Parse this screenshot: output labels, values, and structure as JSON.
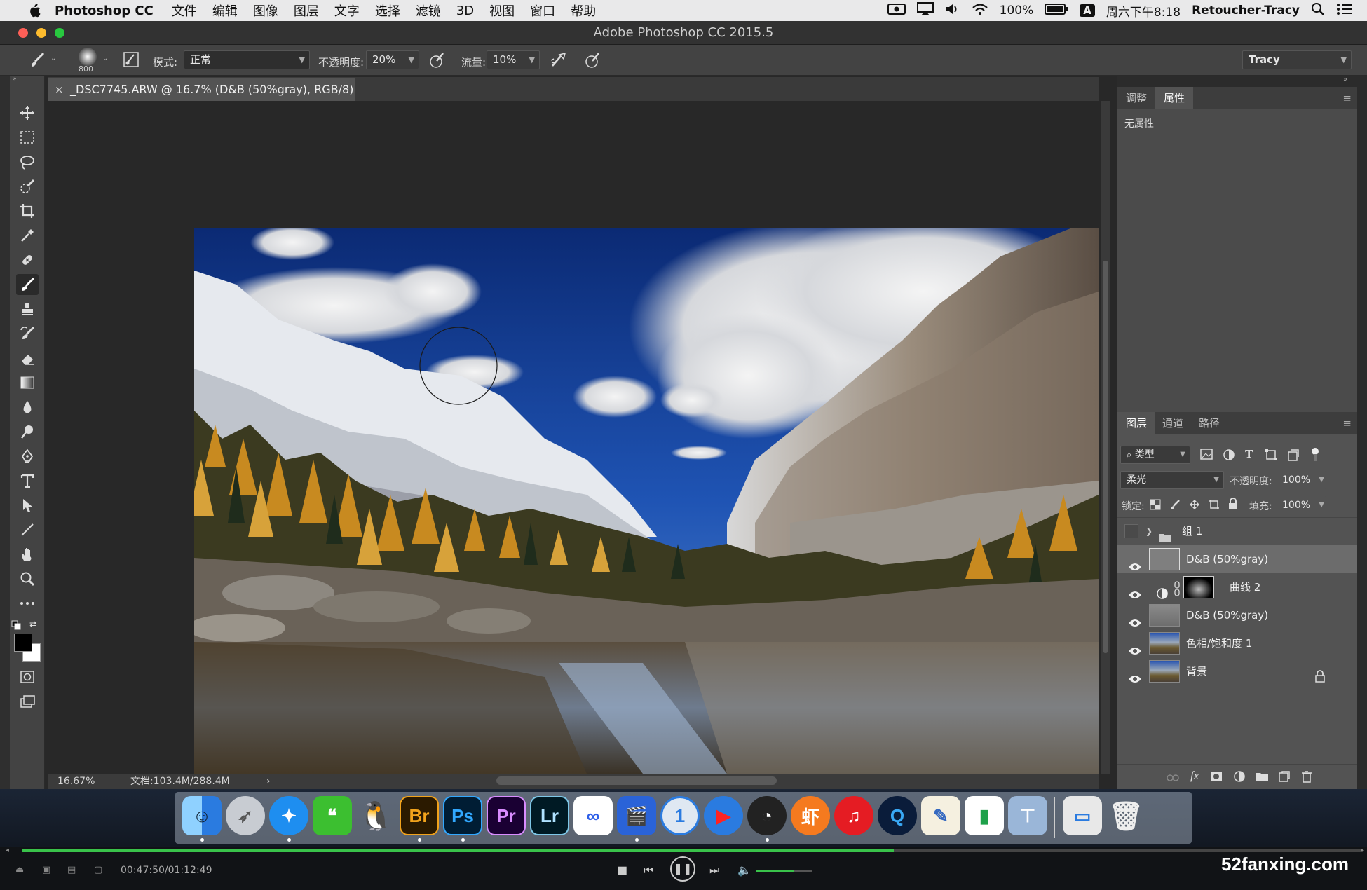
{
  "menubar": {
    "app": "Photoshop CC",
    "items": [
      "文件",
      "编辑",
      "图像",
      "图层",
      "文字",
      "选择",
      "滤镜",
      "3D",
      "视图",
      "窗口",
      "帮助"
    ],
    "battery": "100%",
    "input_method": "A",
    "clock": "周六下午8:18",
    "user": "Retoucher-Tracy"
  },
  "window": {
    "title": "Adobe Photoshop CC 2015.5"
  },
  "options": {
    "brush_size": "800",
    "mode_label": "模式:",
    "mode_value": "正常",
    "opacity_label": "不透明度:",
    "opacity_value": "20%",
    "flow_label": "流量:",
    "flow_value": "10%",
    "workspace": "Tracy"
  },
  "document": {
    "tab_title": "_DSC7745.ARW @ 16.7% (D&B  (50%gray), RGB/8) *",
    "zoom": "16.67%",
    "doc_size": "文档:103.4M/288.4M",
    "status_arrow": "›"
  },
  "properties_panel": {
    "tabs": [
      "调整",
      "属性"
    ],
    "active_tab": 1,
    "body_text": "无属性"
  },
  "layers_panel": {
    "tabs": [
      "图层",
      "通道",
      "路径"
    ],
    "active_tab": 0,
    "filter_kind": "类型",
    "blend_mode": "柔光",
    "opacity_label": "不透明度:",
    "opacity_value": "100%",
    "lock_label": "锁定:",
    "fill_label": "填充:",
    "fill_value": "100%",
    "layers": [
      {
        "name": "组 1",
        "type": "group",
        "visible": false
      },
      {
        "name": "D&B  (50%gray)",
        "type": "pixel",
        "visible": true,
        "selected": true
      },
      {
        "name": "曲线 2",
        "type": "adjustment",
        "visible": true
      },
      {
        "name": "D&B  (50%gray)",
        "type": "pixel",
        "visible": true
      },
      {
        "name": "色相/饱和度 1",
        "type": "adjustment",
        "visible": true
      },
      {
        "name": "背景",
        "type": "background",
        "visible": true,
        "locked": true
      }
    ]
  },
  "dock": {
    "apps": [
      "Finder",
      "Launchpad",
      "Safari",
      "WeChat",
      "QQ",
      "Br",
      "Ps",
      "Pr",
      "Lr",
      "Baidu",
      "Movie",
      "1Password",
      "Video",
      "OBS",
      "Xiami",
      "NetEase",
      "QuickTime",
      "TextEdit",
      "Numbers",
      "Keynote",
      "Preview",
      "Trash"
    ]
  },
  "player": {
    "time": "00:47:50/01:12:49",
    "progress": 0.65,
    "watermark": "52fanxing.com"
  },
  "colors": {
    "accent_green": "#39c24a",
    "panel_bg": "#535353",
    "tool_bg": "#434343"
  }
}
